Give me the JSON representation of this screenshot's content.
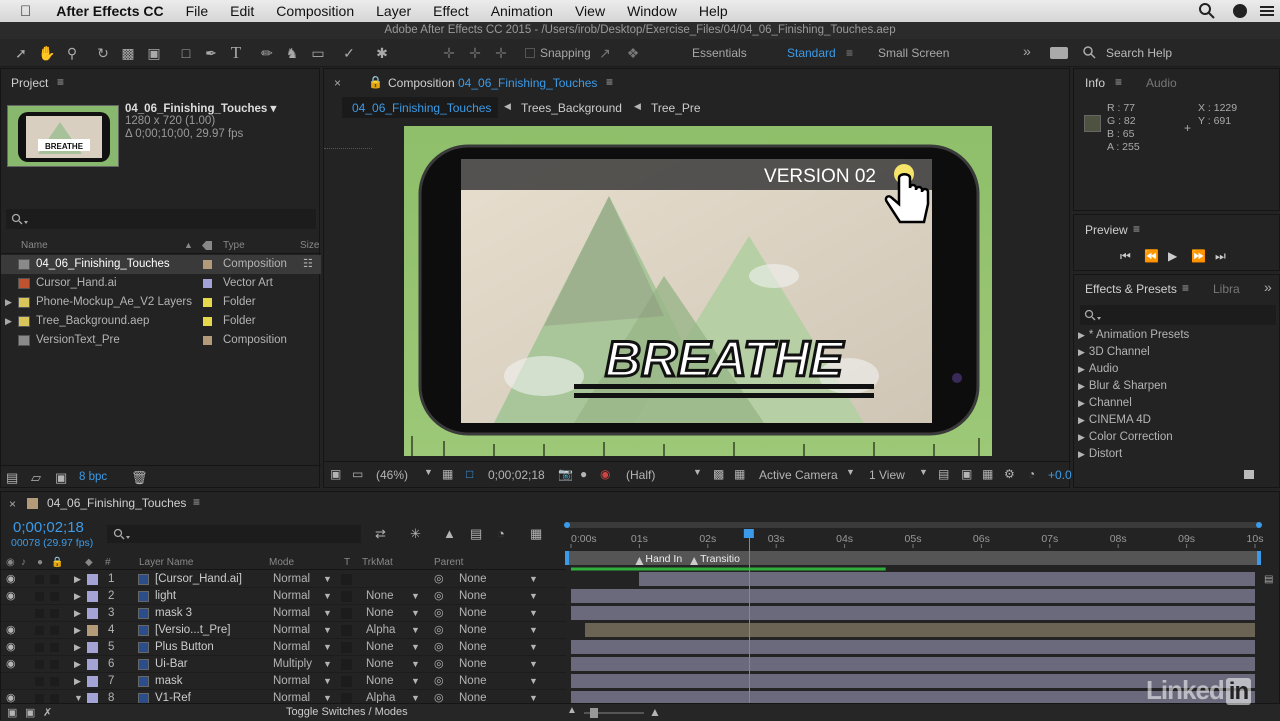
{
  "menubar": {
    "app": "After Effects CC",
    "items": [
      "File",
      "Edit",
      "Composition",
      "Layer",
      "Effect",
      "Animation",
      "View",
      "Window",
      "Help"
    ]
  },
  "titlebar": {
    "title": "Adobe After Effects CC 2015 - /Users/irob/Desktop/Exercise_Files/04/04_06_Finishing_Touches.aep"
  },
  "toolbar": {
    "snapping": "Snapping",
    "workspaces": [
      "Essentials",
      "Standard",
      "Small Screen"
    ],
    "search": "Search Help"
  },
  "project": {
    "tab": "Project",
    "selected_name": "04_06_Finishing_Touches ▾",
    "selected_info1": "1280 x 720 (1.00)",
    "selected_info2": "Δ 0;00;10;00, 29.97 fps",
    "thumb_text": "BREATHE",
    "col_name": "Name",
    "col_type": "Type",
    "col_size": "Size",
    "bpc": "8 bpc",
    "items": [
      {
        "name": "04_06_Finishing_Touches",
        "type": "Composition",
        "color": "#b39b7a",
        "icon": "composition-icon"
      },
      {
        "name": "Cursor_Hand.ai",
        "type": "Vector Art",
        "color": "#a3a3d6",
        "icon": "vector-art-icon"
      },
      {
        "name": "Phone-Mockup_Ae_V2 Layers",
        "type": "Folder",
        "color": "#e6d84a",
        "icon": "folder-icon"
      },
      {
        "name": "Tree_Background.aep",
        "type": "Folder",
        "color": "#e6d84a",
        "icon": "folder-icon"
      },
      {
        "name": "VersionText_Pre",
        "type": "Composition",
        "color": "#b39b7a",
        "icon": "composition-icon"
      }
    ]
  },
  "comp": {
    "tab_label": "Composition",
    "tab_name": "04_06_Finishing_Touches",
    "breadcrumbs": [
      "04_06_Finishing_Touches",
      "Trees_Background",
      "Tree_Pre"
    ],
    "version_text": "VERSION 02",
    "breathe": "BREATHE",
    "zoom": "(46%)",
    "timecode": "0;00;02;18",
    "resolution": "(Half)",
    "camera": "Active Camera",
    "view": "1 View",
    "exposure": "+0.0"
  },
  "info": {
    "tab": "Info",
    "tab2": "Audio",
    "r": "R : 77",
    "g": "G : 82",
    "b": "B : 65",
    "a": "A : 255",
    "x": "X : 1229",
    "y": "Y : 691"
  },
  "preview": {
    "tab": "Preview"
  },
  "effects": {
    "tab": "Effects & Presets",
    "tab2": "Libra",
    "items": [
      "* Animation Presets",
      "3D Channel",
      "Audio",
      "Blur & Sharpen",
      "Channel",
      "CINEMA 4D",
      "Color Correction",
      "Distort"
    ]
  },
  "timeline": {
    "tab": "04_06_Finishing_Touches",
    "timecode": "0;00;02;18",
    "frames": "00078 (29.97 fps)",
    "col_layer": "Layer Name",
    "col_mode": "Mode",
    "col_t": "T",
    "col_trkmat": "TrkMat",
    "col_parent": "Parent",
    "col_num": "#",
    "ruler": [
      "0:00s",
      "01s",
      "02s",
      "03s",
      "04s",
      "05s",
      "06s",
      "07s",
      "08s",
      "09s",
      "10s"
    ],
    "markers": [
      "Hand In",
      "Transitio"
    ],
    "toggle": "Toggle Switches / Modes",
    "current_time_s": 2.6,
    "duration_s": 10,
    "layers": [
      {
        "num": "1",
        "name": "[Cursor_Hand.ai]",
        "mode": "Normal",
        "trkmat": "",
        "parent": "None",
        "color": "#a3a3d6",
        "eye": true,
        "start": 1.0,
        "end": 10
      },
      {
        "num": "2",
        "name": "light",
        "mode": "Normal",
        "trkmat": "None",
        "parent": "None",
        "color": "#a3a3d6",
        "eye": true,
        "start": 0,
        "end": 10
      },
      {
        "num": "3",
        "name": "mask 3",
        "mode": "Normal",
        "trkmat": "None",
        "parent": "None",
        "color": "#a3a3d6",
        "eye": false,
        "start": 0,
        "end": 10
      },
      {
        "num": "4",
        "name": "[Versio...t_Pre]",
        "mode": "Normal",
        "trkmat": "Alpha",
        "parent": "None",
        "color": "#b39b7a",
        "eye": true,
        "start": 0.2,
        "end": 10
      },
      {
        "num": "5",
        "name": "Plus Button",
        "mode": "Normal",
        "trkmat": "None",
        "parent": "None",
        "color": "#a3a3d6",
        "eye": true,
        "start": 0,
        "end": 10
      },
      {
        "num": "6",
        "name": "Ui-Bar",
        "mode": "Multiply",
        "trkmat": "None",
        "parent": "None",
        "color": "#a3a3d6",
        "eye": true,
        "start": 0,
        "end": 10
      },
      {
        "num": "7",
        "name": "mask",
        "mode": "Normal",
        "trkmat": "None",
        "parent": "None",
        "color": "#a3a3d6",
        "eye": false,
        "start": 0,
        "end": 10
      },
      {
        "num": "8",
        "name": "V1-Ref",
        "mode": "Normal",
        "trkmat": "Alpha",
        "parent": "None",
        "color": "#a3a3d6",
        "eye": true,
        "start": 0,
        "end": 10
      }
    ]
  },
  "watermark": "Linked"
}
